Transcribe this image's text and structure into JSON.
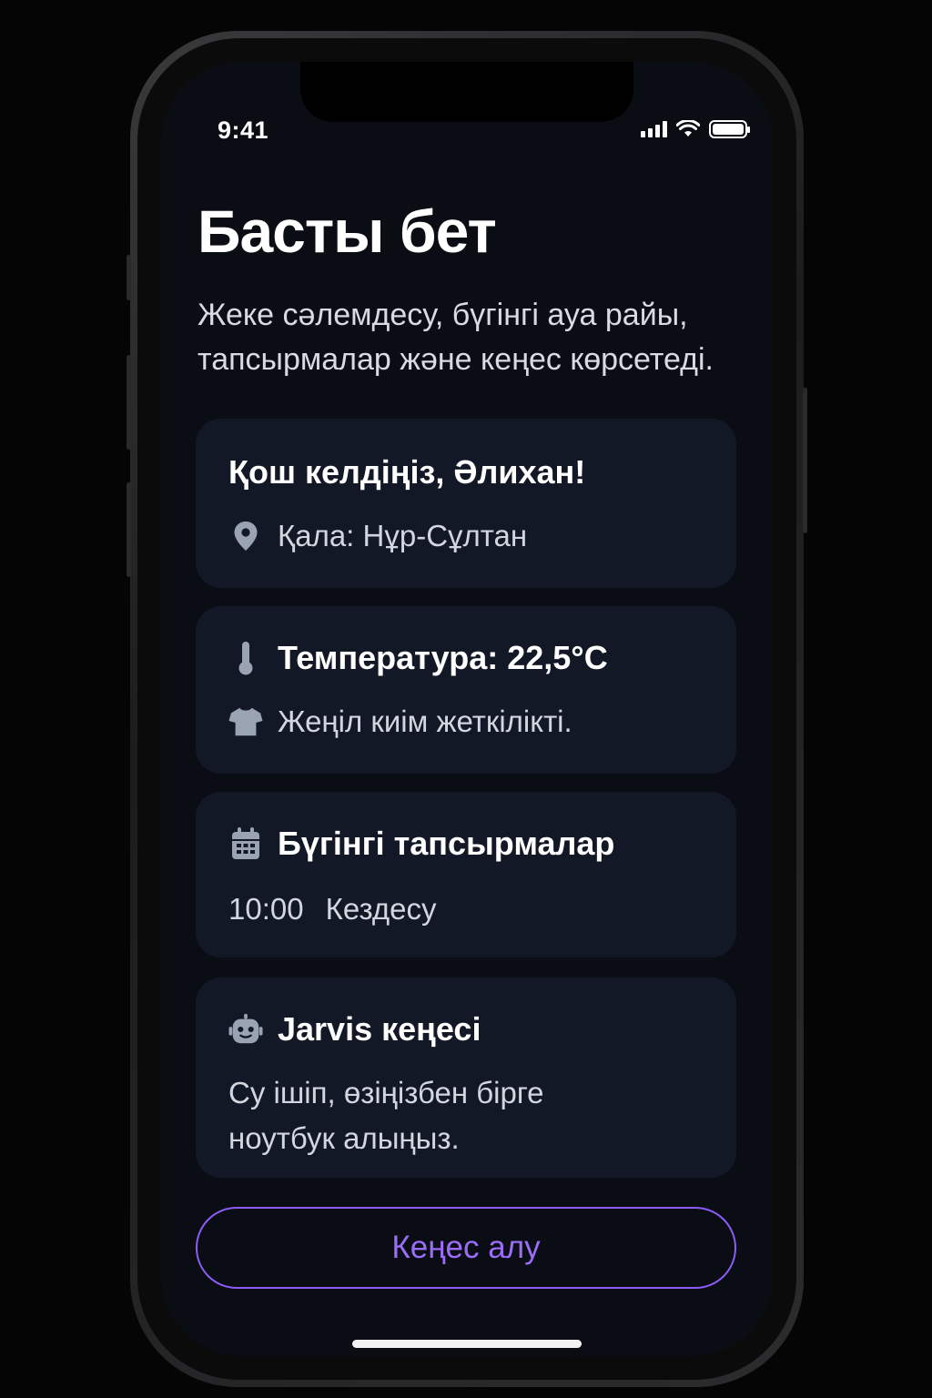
{
  "status_bar": {
    "time": "9:41"
  },
  "page": {
    "title": "Басты бет",
    "description": "Жеке сәлемдесу, бүгінгі ауа райы, тапсырмалар және кеңес көрсетеді."
  },
  "greeting_card": {
    "title": "Қош келдіңіз, Әлихан!",
    "city": "Қала: Нұр-Сұлтан",
    "icon": "location-pin-icon"
  },
  "weather_card": {
    "title": "Температура: 22,5°C",
    "advice": "Жеңіл киім жеткілікті.",
    "icons": [
      "thermometer-icon",
      "tshirt-icon"
    ]
  },
  "tasks_card": {
    "title": "Бүгінгі тапсырмалар",
    "icon": "calendar-icon",
    "tasks": [
      {
        "time": "10:00",
        "name": "Кездесу"
      }
    ]
  },
  "jarvis_card": {
    "title": "Jarvis кеңесі",
    "icon": "robot-icon",
    "advice": "Су ішіп, өзіңізбен бірге ноутбук алыңыз."
  },
  "actions": {
    "get_advice_label": "Кеңес алу"
  },
  "colors": {
    "background": "#0a0d14",
    "card": "#121826",
    "accent": "#8b5cf6",
    "text": "#ffffff",
    "icon": "#9aa3b2"
  }
}
